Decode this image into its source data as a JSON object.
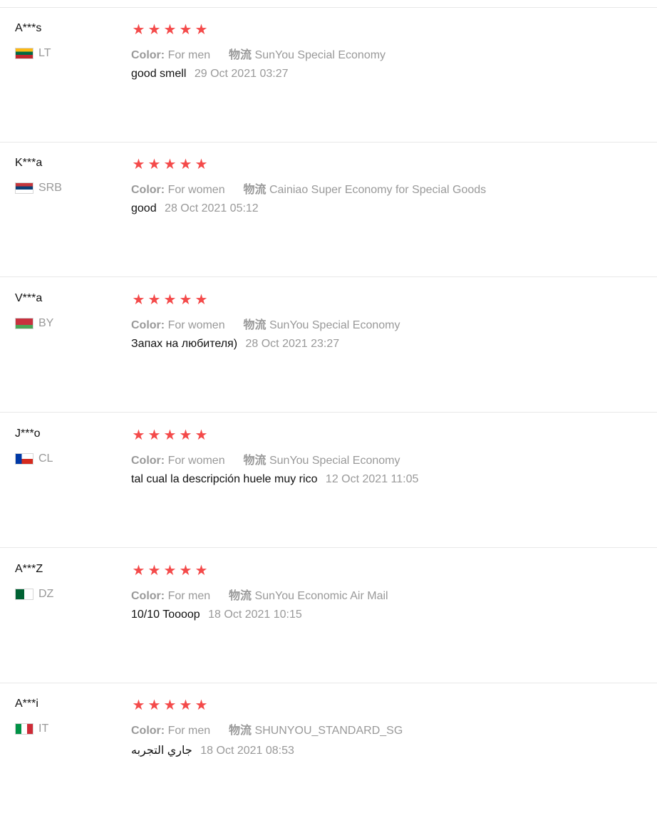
{
  "color_label": "Color:",
  "logistics_label": "物流",
  "star_color": "#f44a4a",
  "reviews": [
    {
      "user": "A***s",
      "country": "LT",
      "flag": [
        "#fdb913",
        "#006a44",
        "#c1272d"
      ],
      "rating": 5,
      "color_value": "For men",
      "logistics_value": "SunYou Special Economy",
      "comment": "good smell",
      "date": "29 Oct 2021 03:27"
    },
    {
      "user": "K***a",
      "country": "SRB",
      "flag": [
        "#c6363c",
        "#0c4076",
        "#ffffff"
      ],
      "rating": 5,
      "color_value": "For women",
      "logistics_value": "Cainiao Super Economy for Special Goods",
      "comment": "good",
      "date": "28 Oct 2021 05:12"
    },
    {
      "user": "V***a",
      "country": "BY",
      "flag": [
        "#c8313e",
        "#c8313e",
        "#4aa657"
      ],
      "rating": 5,
      "color_value": "For women",
      "logistics_value": "SunYou Special Economy",
      "comment": "Запах на любителя)",
      "date": "28 Oct 2021 23:27"
    },
    {
      "user": "J***o",
      "country": "CL",
      "flag": [
        "#ffffff",
        "#d52b1e",
        "#0039a6"
      ],
      "rating": 5,
      "color_value": "For women",
      "logistics_value": "SunYou Special Economy",
      "comment": "tal cual la descripción huele muy rico",
      "date": "12 Oct 2021 11:05"
    },
    {
      "user": "A***Z",
      "country": "DZ",
      "flag": [
        "#006233",
        "#ffffff",
        "#d21034"
      ],
      "rating": 5,
      "color_value": "For men",
      "logistics_value": "SunYou Economic Air Mail",
      "comment": "10/10 Toooop",
      "date": "18 Oct 2021 10:15"
    },
    {
      "user": "A***i",
      "country": "IT",
      "flag": [
        "#009246",
        "#ffffff",
        "#ce2b37"
      ],
      "rating": 5,
      "color_value": "For men",
      "logistics_value": "SHUNYOU_STANDARD_SG",
      "comment": "جاري التجربه",
      "date": "18 Oct 2021 08:53"
    }
  ]
}
